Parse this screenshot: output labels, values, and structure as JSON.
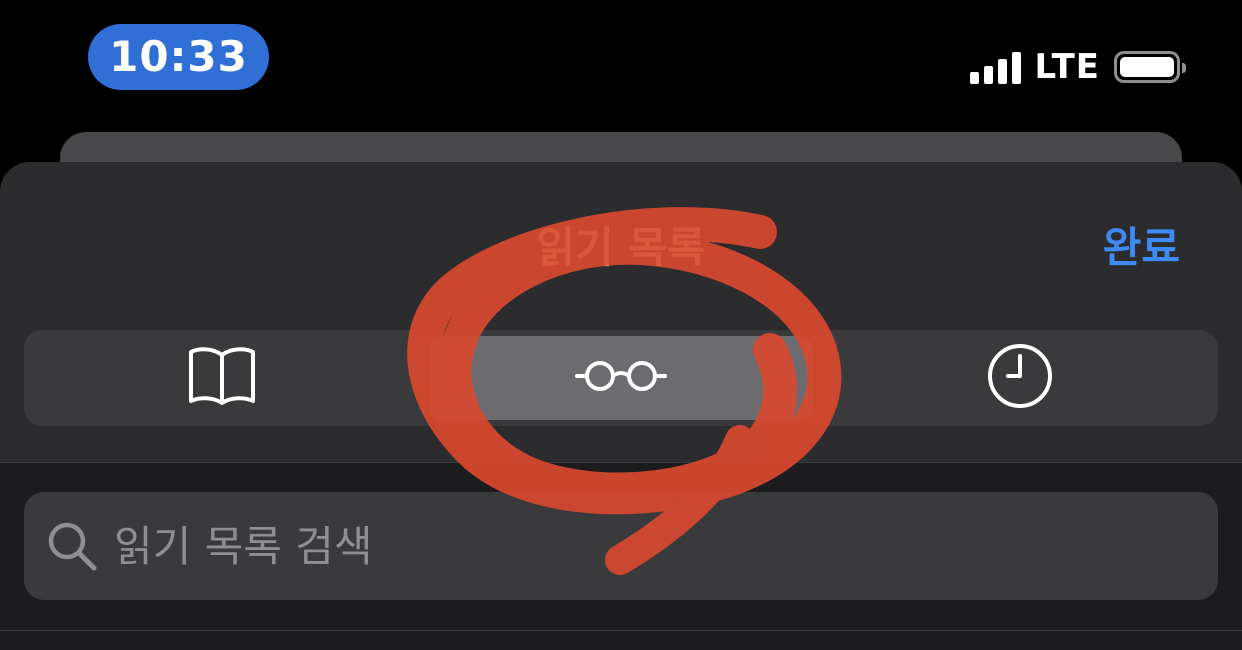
{
  "status_bar": {
    "time": "10:33",
    "network": "LTE",
    "accent": "#2f6fd6"
  },
  "sheet": {
    "title": "읽기 목록",
    "done_label": "완료",
    "done_color": "#3e8bf7"
  },
  "segments": [
    {
      "icon": "book-icon",
      "selected": false
    },
    {
      "icon": "glasses-icon",
      "selected": true
    },
    {
      "icon": "clock-icon",
      "selected": false
    }
  ],
  "search": {
    "placeholder": "읽기 목록 검색",
    "value": ""
  },
  "annotation": {
    "icon": "red-circle-scribble",
    "color": "#d9492e"
  }
}
